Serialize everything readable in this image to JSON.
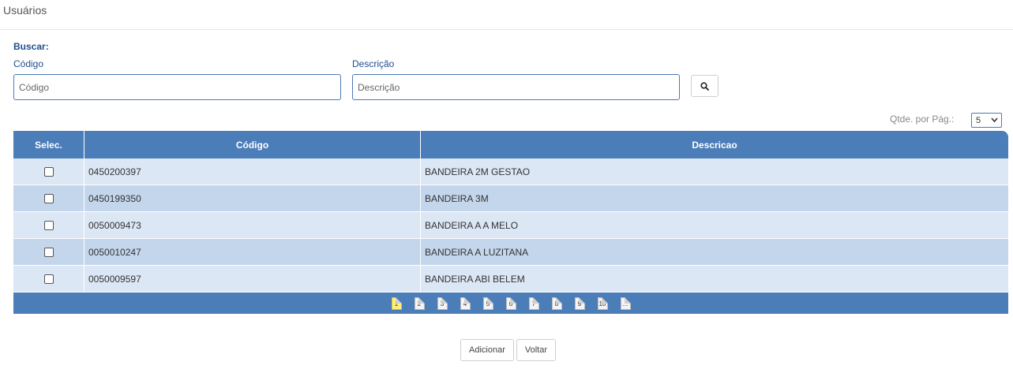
{
  "page": {
    "title": "Usuários"
  },
  "search": {
    "heading": "Buscar:",
    "codigo_label": "Código",
    "codigo_placeholder": "Código",
    "descricao_label": "Descrição",
    "descricao_placeholder": "Descrição",
    "search_icon": "search-icon"
  },
  "pagination": {
    "per_page_label": "Qtde. por Pág.:",
    "per_page_value": "5",
    "current_page": 1,
    "pages": [
      "1",
      "2",
      "3",
      "4",
      "5",
      "6",
      "7",
      "8",
      "9",
      "10",
      "..."
    ]
  },
  "table": {
    "columns": [
      "Selec.",
      "Código",
      "Descricao"
    ],
    "rows": [
      {
        "codigo": "0450200397",
        "descricao": "BANDEIRA 2M GESTAO",
        "selected": false
      },
      {
        "codigo": "0450199350",
        "descricao": "BANDEIRA 3M",
        "selected": false
      },
      {
        "codigo": "0050009473",
        "descricao": "BANDEIRA A A MELO",
        "selected": false
      },
      {
        "codigo": "0050010247",
        "descricao": "BANDEIRA A LUZITANA",
        "selected": false
      },
      {
        "codigo": "0050009597",
        "descricao": "BANDEIRA ABI BELEM",
        "selected": false
      }
    ]
  },
  "actions": {
    "add_label": "Adicionar",
    "back_label": "Voltar"
  },
  "colors": {
    "header": "#4b7db8",
    "row_odd": "#dce7f5",
    "row_even": "#c4d6ec",
    "accent_text": "#1f4e8c",
    "active_page": "#fff07a"
  }
}
